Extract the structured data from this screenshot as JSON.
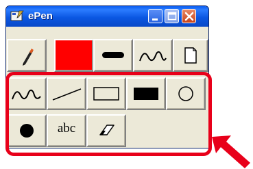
{
  "window": {
    "title": "ePen",
    "controls": [
      "minimize",
      "maximize",
      "close"
    ]
  },
  "toolbar": {
    "row1": [
      {
        "name": "pen-tool",
        "icon": "pen-icon"
      },
      {
        "name": "color-picker",
        "icon": "color-swatch",
        "color": "#ff0000"
      },
      {
        "name": "line-width",
        "icon": "thick-line-icon"
      },
      {
        "name": "stroke-style",
        "icon": "freehand-icon"
      },
      {
        "name": "new-page",
        "icon": "page-icon"
      }
    ],
    "row2": [
      {
        "name": "freehand-tool",
        "icon": "freehand-icon"
      },
      {
        "name": "line-tool",
        "icon": "line-icon"
      },
      {
        "name": "rectangle-tool",
        "icon": "rectangle-outline-icon"
      },
      {
        "name": "filled-rectangle-tool",
        "icon": "rectangle-filled-icon"
      },
      {
        "name": "ellipse-tool",
        "icon": "circle-outline-icon"
      }
    ],
    "row3": [
      {
        "name": "filled-ellipse-tool",
        "icon": "circle-filled-icon"
      },
      {
        "name": "text-tool",
        "icon": "text-icon",
        "label": "abc"
      },
      {
        "name": "eraser-tool",
        "icon": "eraser-icon"
      }
    ]
  },
  "annotation": {
    "highlight_color": "#e8001a",
    "icon": "arrow-icon"
  }
}
